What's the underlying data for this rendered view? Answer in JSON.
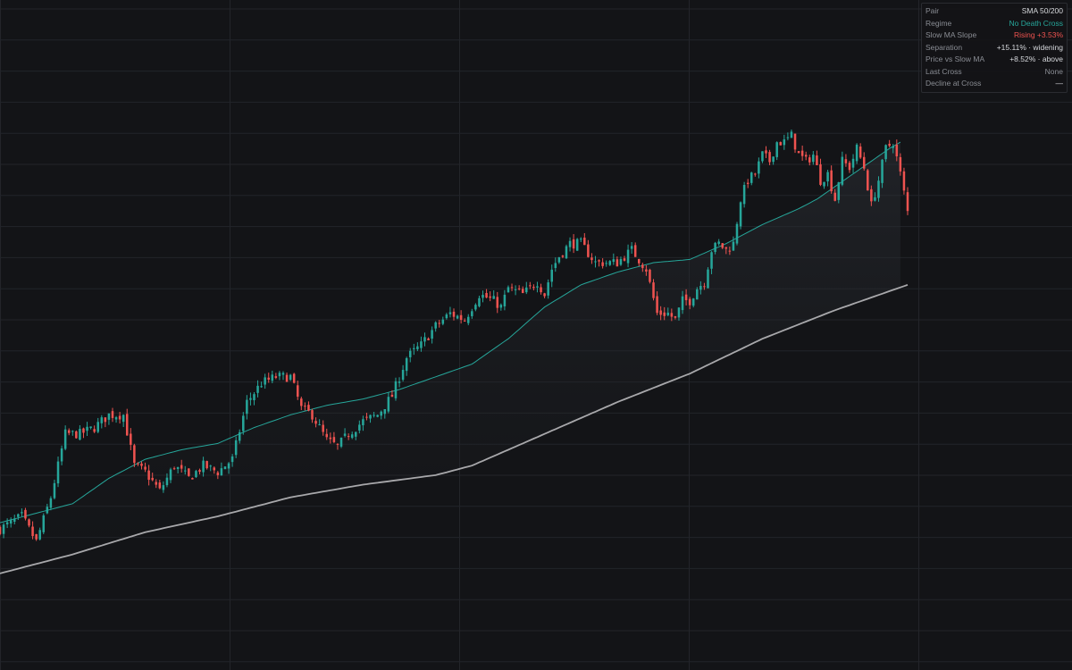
{
  "info_panel": {
    "rows": [
      {
        "label": "Pair",
        "value": "SMA 50/200",
        "tone": "neutral"
      },
      {
        "label": "Regime",
        "value": "No Death Cross",
        "tone": "green"
      },
      {
        "label": "Slow MA Slope",
        "value": "Rising +3.53%",
        "tone": "red"
      },
      {
        "label": "Separation",
        "value": "+15.11% · widening",
        "tone": "neutral"
      },
      {
        "label": "Price vs Slow MA",
        "value": "+8.52% · above",
        "tone": "neutral"
      },
      {
        "label": "Last Cross",
        "value": "None",
        "tone": "dim"
      },
      {
        "label": "Decline at Cross",
        "value": "—",
        "tone": "neutral"
      }
    ]
  },
  "colors": {
    "background": "#131417",
    "grid": "#23252a",
    "up": "#26a69a",
    "down": "#ef5350",
    "fast_ma": "#26a69a",
    "slow_ma": "#a8a8ab"
  },
  "chart_data": {
    "type": "candlestick",
    "series": [
      {
        "indicator": "candles",
        "ohlc_generated_from_anchors": true
      },
      {
        "indicator": "SMA 50"
      },
      {
        "indicator": "SMA 200"
      }
    ],
    "index_range": [
      0,
      250
    ],
    "ylim": [
      0,
      100
    ],
    "grid": true,
    "close_anchors": [
      [
        0,
        18
      ],
      [
        6,
        20
      ],
      [
        10,
        16
      ],
      [
        14,
        23
      ],
      [
        18,
        33
      ],
      [
        22,
        33
      ],
      [
        26,
        34
      ],
      [
        30,
        36
      ],
      [
        34,
        36
      ],
      [
        37,
        28
      ],
      [
        40,
        27
      ],
      [
        44,
        24
      ],
      [
        48,
        28
      ],
      [
        52,
        26
      ],
      [
        56,
        28
      ],
      [
        60,
        27
      ],
      [
        64,
        29
      ],
      [
        68,
        38
      ],
      [
        72,
        41
      ],
      [
        76,
        42
      ],
      [
        80,
        42
      ],
      [
        83,
        37
      ],
      [
        86,
        36
      ],
      [
        90,
        32
      ],
      [
        93,
        31
      ],
      [
        96,
        33
      ],
      [
        100,
        35
      ],
      [
        104,
        36
      ],
      [
        108,
        39
      ],
      [
        112,
        45
      ],
      [
        116,
        47
      ],
      [
        120,
        50
      ],
      [
        124,
        52
      ],
      [
        128,
        51
      ],
      [
        132,
        55
      ],
      [
        136,
        54
      ],
      [
        138,
        53
      ],
      [
        140,
        56
      ],
      [
        144,
        55
      ],
      [
        148,
        57
      ],
      [
        150,
        55
      ],
      [
        152,
        59
      ],
      [
        154,
        61
      ],
      [
        157,
        63
      ],
      [
        160,
        63
      ],
      [
        164,
        60
      ],
      [
        168,
        60
      ],
      [
        170,
        60
      ],
      [
        174,
        62
      ],
      [
        178,
        59
      ],
      [
        181,
        52
      ],
      [
        184,
        52
      ],
      [
        186,
        51
      ],
      [
        188,
        54
      ],
      [
        190,
        54
      ],
      [
        192,
        56
      ],
      [
        194,
        57
      ],
      [
        196,
        62
      ],
      [
        198,
        63
      ],
      [
        200,
        62
      ],
      [
        202,
        63
      ],
      [
        204,
        70
      ],
      [
        206,
        73
      ],
      [
        208,
        74
      ],
      [
        210,
        77
      ],
      [
        212,
        76
      ],
      [
        214,
        79
      ],
      [
        216,
        79
      ],
      [
        218,
        80
      ],
      [
        220,
        77
      ],
      [
        222,
        76
      ],
      [
        224,
        77
      ],
      [
        226,
        73
      ],
      [
        228,
        74
      ],
      [
        230,
        70
      ],
      [
        232,
        76
      ],
      [
        234,
        75
      ],
      [
        236,
        78
      ],
      [
        238,
        75
      ],
      [
        240,
        69
      ],
      [
        242,
        73
      ],
      [
        244,
        78
      ],
      [
        246,
        79
      ],
      [
        248,
        74
      ],
      [
        250,
        68
      ]
    ],
    "sma_fast_anchors": [
      [
        0,
        19
      ],
      [
        10,
        20.5
      ],
      [
        20,
        22
      ],
      [
        30,
        26
      ],
      [
        40,
        29
      ],
      [
        50,
        30.5
      ],
      [
        60,
        31.5
      ],
      [
        70,
        34
      ],
      [
        80,
        36
      ],
      [
        90,
        37.5
      ],
      [
        100,
        38.5
      ],
      [
        110,
        40
      ],
      [
        120,
        42
      ],
      [
        130,
        44
      ],
      [
        140,
        48
      ],
      [
        150,
        53
      ],
      [
        160,
        56.5
      ],
      [
        170,
        58.5
      ],
      [
        180,
        60
      ],
      [
        190,
        60.5
      ],
      [
        200,
        63
      ],
      [
        210,
        66
      ],
      [
        220,
        68.5
      ],
      [
        225,
        70
      ],
      [
        230,
        72
      ],
      [
        235,
        74
      ],
      [
        240,
        76
      ],
      [
        245,
        78
      ],
      [
        248,
        79
      ]
    ],
    "sma_slow_anchors": [
      [
        0,
        11
      ],
      [
        20,
        14
      ],
      [
        40,
        17.5
      ],
      [
        60,
        20
      ],
      [
        80,
        23
      ],
      [
        100,
        25
      ],
      [
        120,
        26.5
      ],
      [
        130,
        28
      ],
      [
        150,
        33
      ],
      [
        170,
        38
      ],
      [
        190,
        42.5
      ],
      [
        210,
        48
      ],
      [
        230,
        52.5
      ],
      [
        250,
        56.5
      ]
    ]
  }
}
